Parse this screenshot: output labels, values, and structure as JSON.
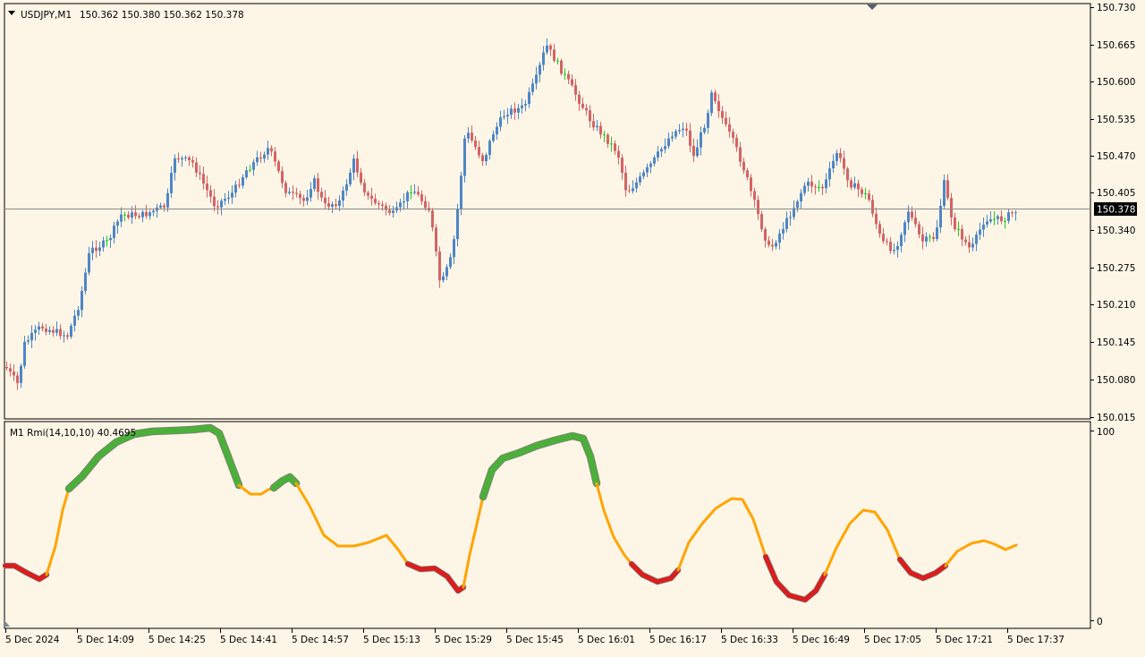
{
  "main_chart": {
    "symbol_label": "USDJPY,M1",
    "ohlc_label": "150.362 150.380 150.362 150.378",
    "current_price_label": "150.378",
    "current_price": 150.378,
    "price_axis_labels": [
      "150.730",
      "150.665",
      "150.600",
      "150.535",
      "150.470",
      "150.405",
      "150.340",
      "150.275",
      "150.210",
      "150.145",
      "150.080",
      "150.015"
    ],
    "bull_color": "#4f86c6",
    "bear_color": "#d46464",
    "doji_color": "#22cc22",
    "price_line_color": "#8a8a8a"
  },
  "indicator": {
    "label": "M1 Rmi(14,10,10) 40.4695",
    "axis_labels": [
      "100",
      "0"
    ],
    "up_color": "#4caf3a",
    "neutral_color": "#ffa500",
    "down_color": "#dd1c1c"
  },
  "time_axis": {
    "labels": [
      "5 Dec 2024",
      "5 Dec 14:09",
      "5 Dec 14:25",
      "5 Dec 14:41",
      "5 Dec 14:57",
      "5 Dec 15:13",
      "5 Dec 15:29",
      "5 Dec 15:45",
      "5 Dec 16:01",
      "5 Dec 16:17",
      "5 Dec 16:33",
      "5 Dec 16:49",
      "5 Dec 17:05",
      "5 Dec 17:21",
      "5 Dec 17:37"
    ]
  }
}
